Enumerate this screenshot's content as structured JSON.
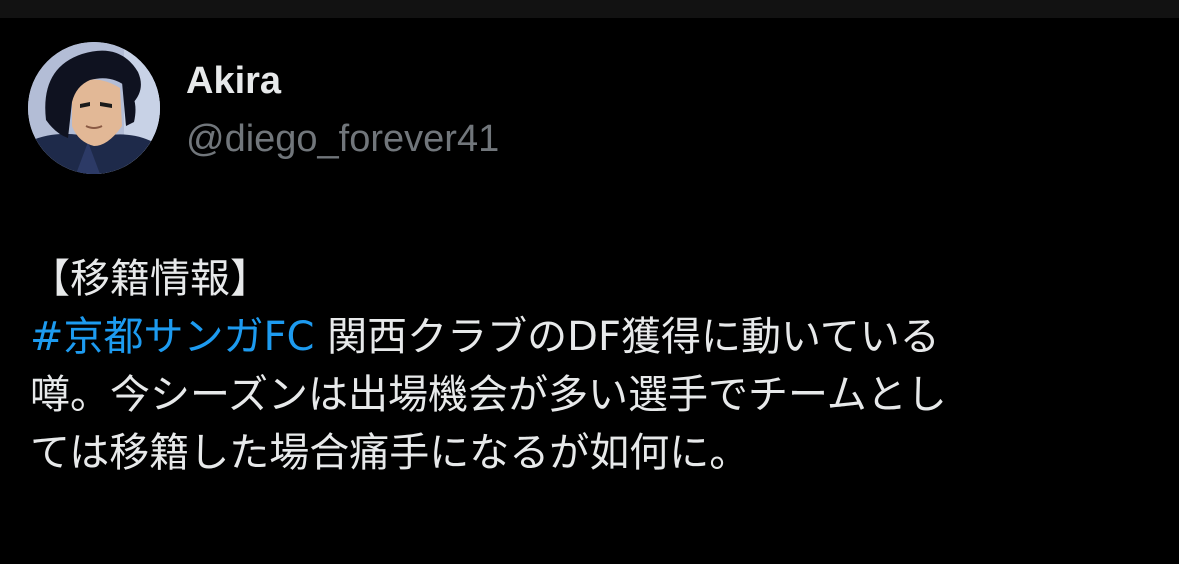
{
  "colors": {
    "background": "#000000",
    "text_primary": "#e7e9ea",
    "text_secondary": "#71767b",
    "accent_link": "#1d9bf0"
  },
  "author": {
    "display_name": "Akira",
    "handle": "@diego_forever41",
    "avatar_icon": "anime-character-avatar"
  },
  "tweet": {
    "heading": "【移籍情報】",
    "hashtag": "#京都サンガFC",
    "line1_rest": " 関西クラブのDF獲得に動いている",
    "line2": "噂。今シーズンは出場機会が多い選手でチームとし",
    "line3": "ては移籍した場合痛手になるが如何に。"
  }
}
